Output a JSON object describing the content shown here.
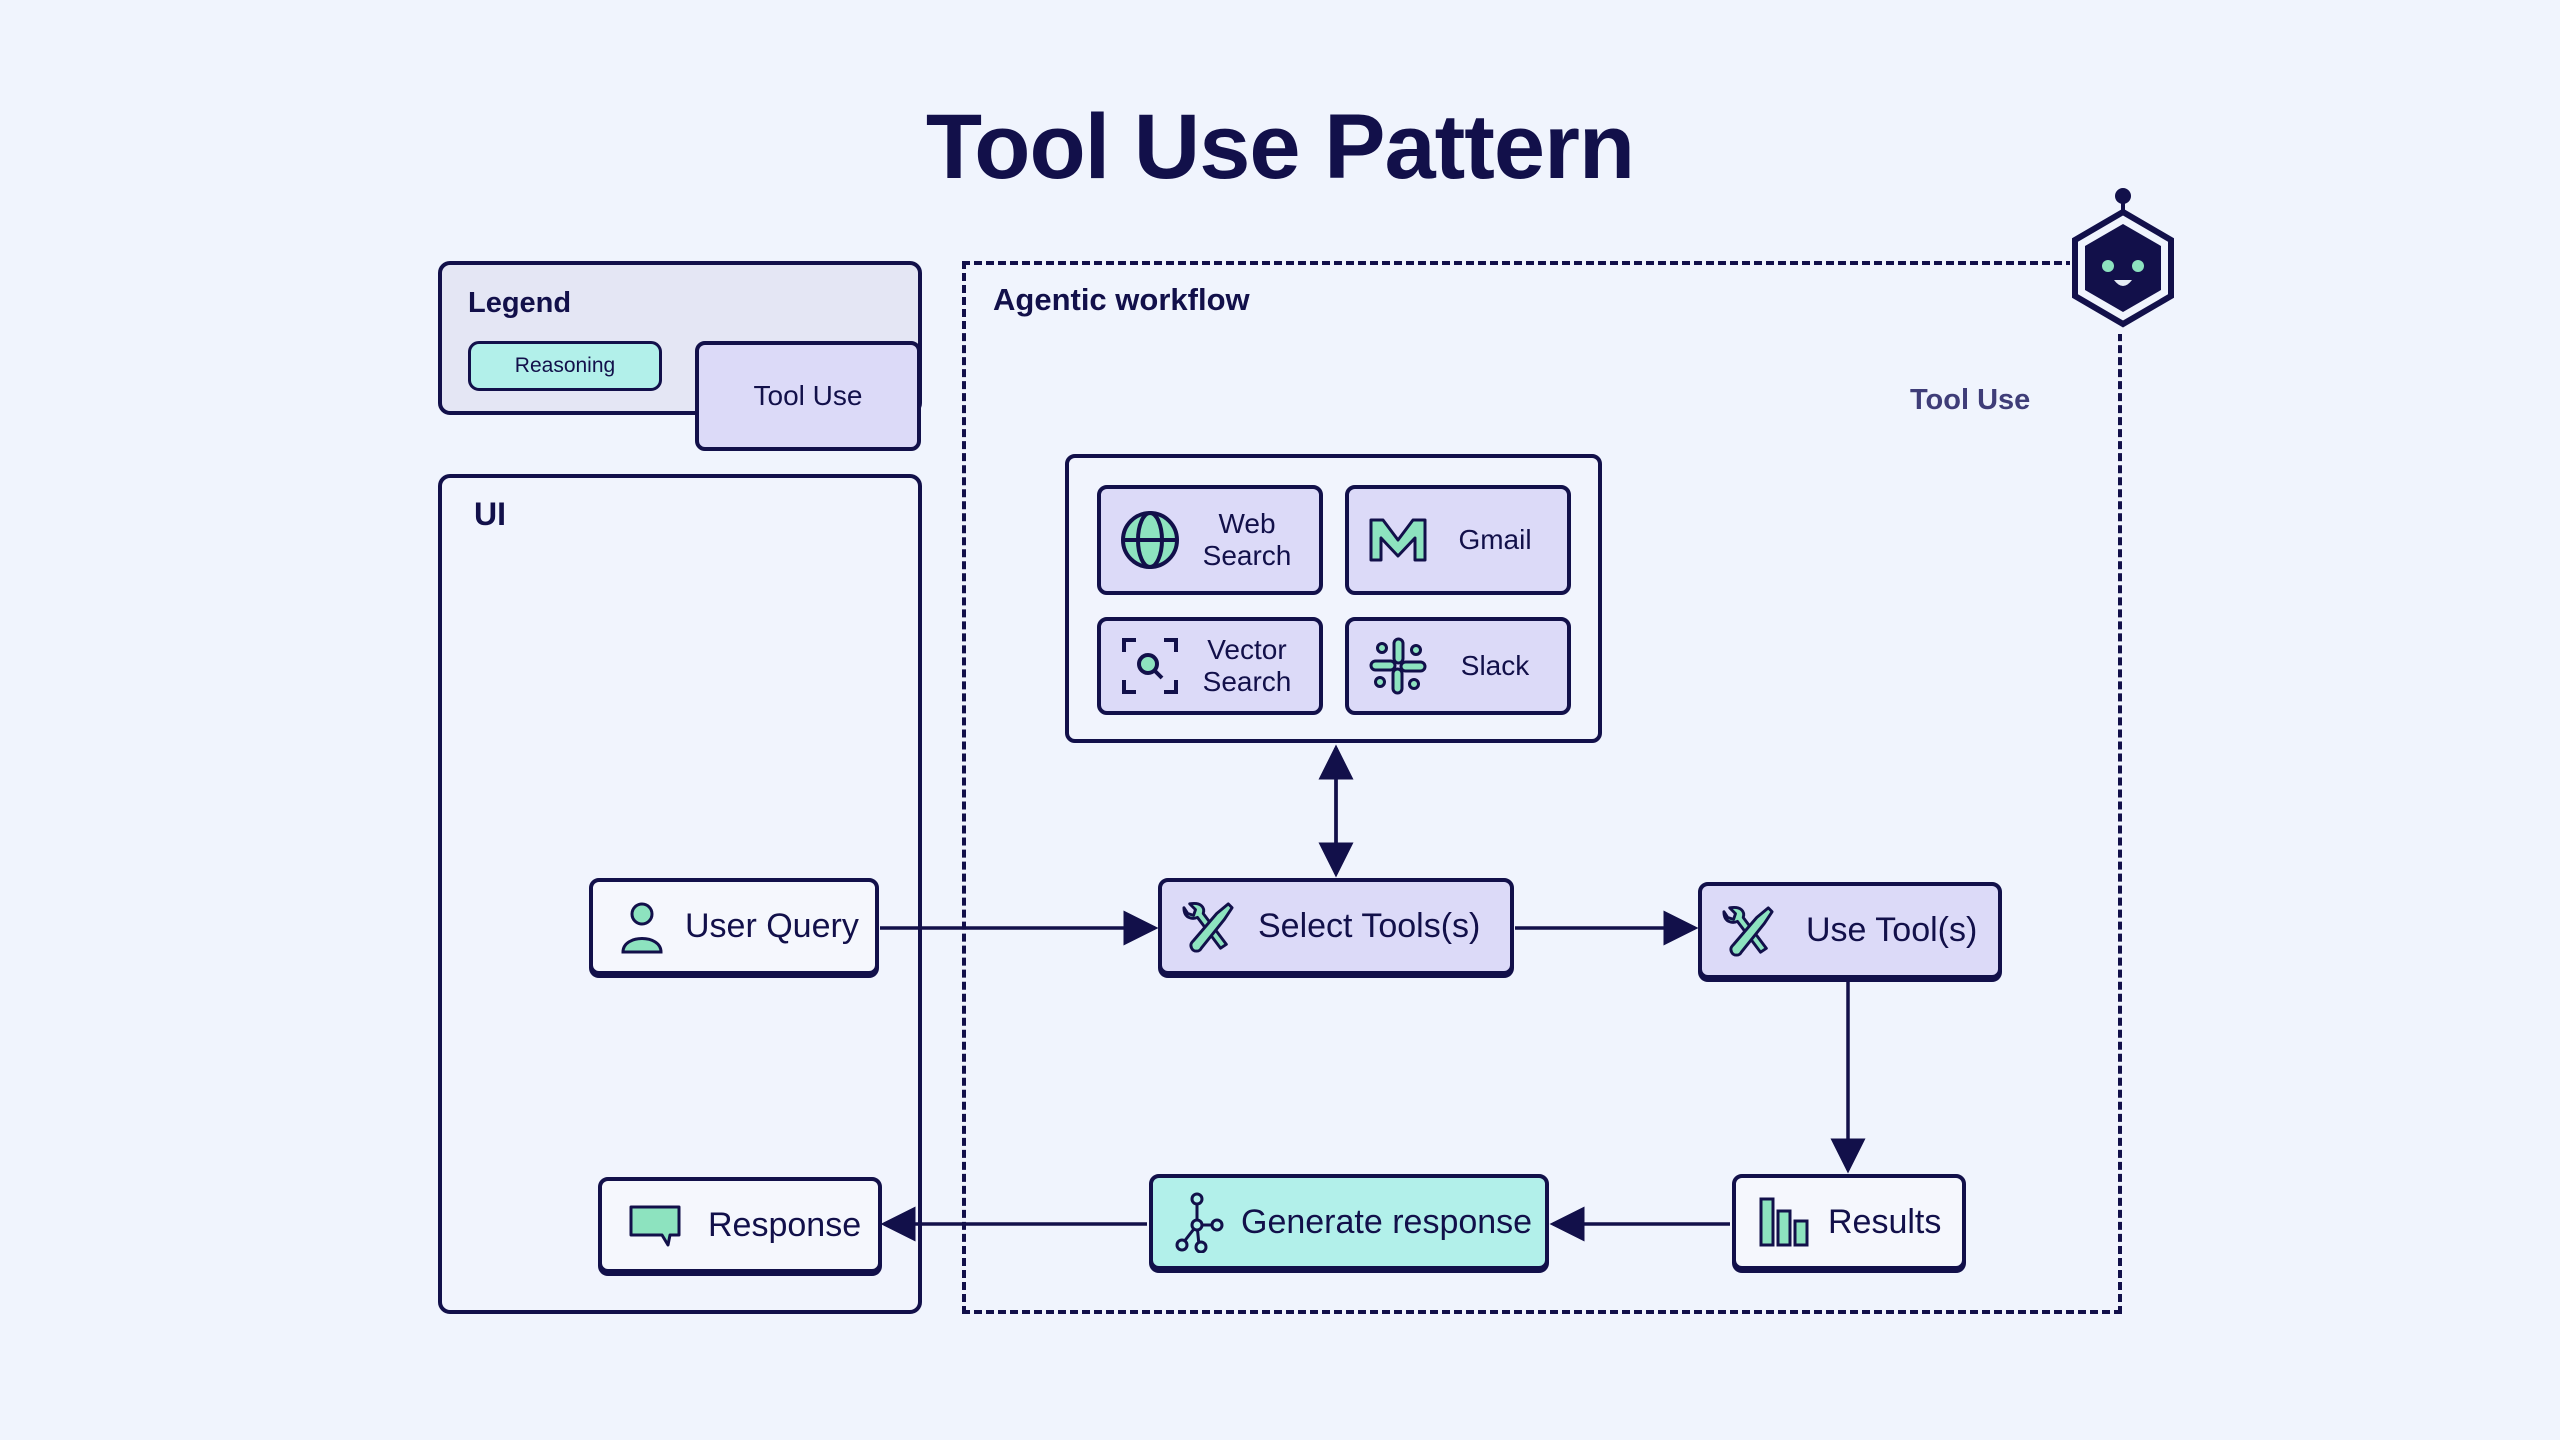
{
  "title": "Tool Use Pattern",
  "legend": {
    "title": "Legend",
    "items": [
      {
        "label": "Reasoning",
        "color": "#b2f0ea"
      },
      {
        "label": "Tool Use",
        "color": "#dcdaf8"
      }
    ]
  },
  "ui_panel": {
    "label": "UI"
  },
  "workflow": {
    "label": "Agentic workflow",
    "group_label": "Tool Use"
  },
  "tools": {
    "web_search": {
      "line1": "Web",
      "line2": "Search",
      "icon": "globe-icon"
    },
    "gmail": {
      "label": "Gmail",
      "icon": "gmail-icon"
    },
    "vector_search": {
      "line1": "Vector",
      "line2": "Search",
      "icon": "vector-search-icon"
    },
    "slack": {
      "label": "Slack",
      "icon": "slack-icon"
    }
  },
  "nodes": {
    "user_query": {
      "label": "User Query",
      "icon": "user-icon"
    },
    "select_tools": {
      "label": "Select Tools(s)",
      "icon": "tools-icon"
    },
    "use_tools": {
      "label": "Use Tool(s)",
      "icon": "tools-icon"
    },
    "results": {
      "label": "Results",
      "icon": "bar-chart-icon"
    },
    "generate": {
      "label": "Generate response",
      "icon": "network-icon"
    },
    "response": {
      "label": "Response",
      "icon": "chat-bubble-icon"
    }
  },
  "colors": {
    "ink": "#12104a",
    "accent": "#8de3bf",
    "reasoning": "#b2f0ea",
    "tool_use": "#dcdaf8",
    "background": "#f0f4fd"
  }
}
